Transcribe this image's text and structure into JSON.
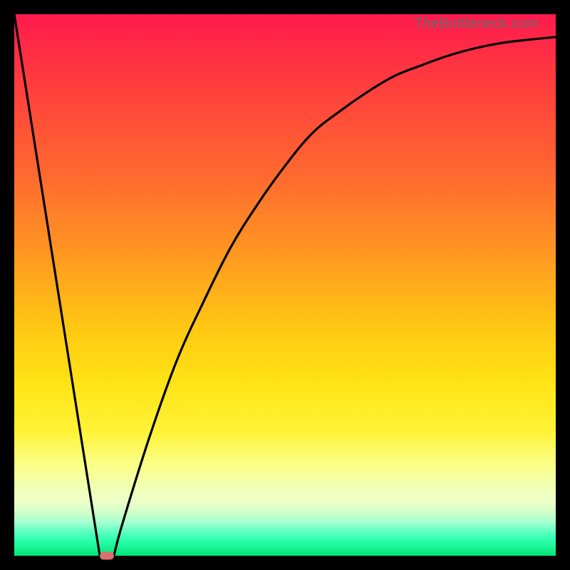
{
  "watermark": "TheBottleneck.com",
  "colors": {
    "frame": "#000000",
    "gradient_top": "#ff1a4d",
    "gradient_mid": "#ffe315",
    "gradient_bottom": "#00e676",
    "curve": "#000000",
    "min_marker": "#d9716f"
  },
  "chart_data": {
    "type": "line",
    "title": "",
    "xlabel": "",
    "ylabel": "",
    "xlim": [
      0,
      100
    ],
    "ylim": [
      0,
      100
    ],
    "series": [
      {
        "name": "left-descent",
        "x": [
          0,
          15.8
        ],
        "values": [
          100,
          0
        ]
      },
      {
        "name": "right-ascent",
        "x": [
          18.4,
          20,
          25,
          30,
          35,
          40,
          45,
          50,
          55,
          60,
          65,
          70,
          75,
          80,
          85,
          90,
          95,
          100
        ],
        "values": [
          0,
          6,
          22,
          36,
          47,
          57,
          65,
          72,
          78,
          82,
          85.5,
          88.5,
          90.5,
          92.3,
          93.7,
          94.7,
          95.3,
          95.8
        ]
      }
    ],
    "min_marker": {
      "x_start": 15.8,
      "x_end": 18.4,
      "y": 0
    }
  }
}
